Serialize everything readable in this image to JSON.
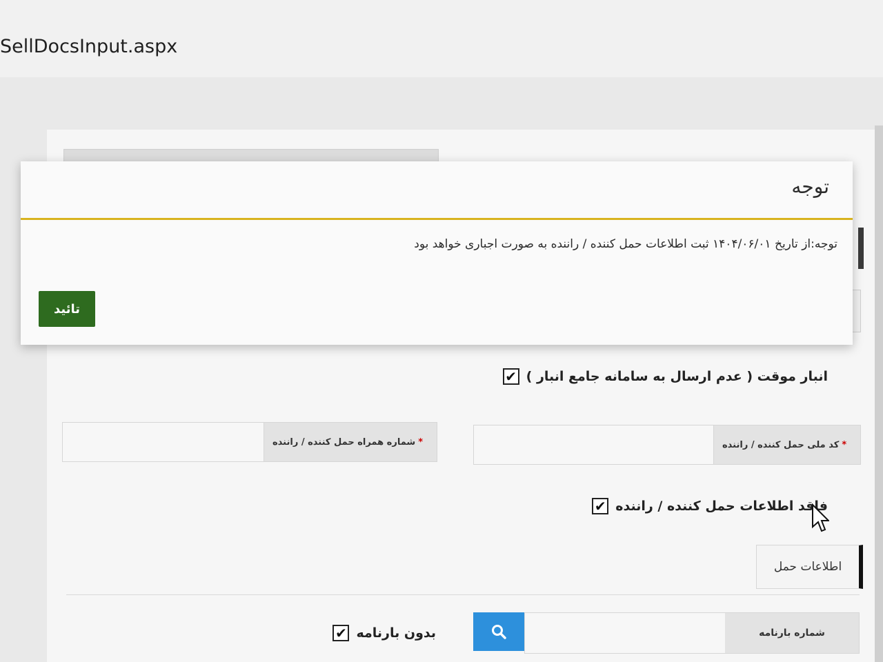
{
  "browser": {
    "url_text": "SellDocsInput.aspx"
  },
  "modal": {
    "title": "توجه",
    "message": "توجه:از تاریخ ۱۴۰۴/۰۶/۰۱ ثبت اطلاعات حمل کننده / راننده به صورت اجباری خواهد بود",
    "confirm_label": "تائید",
    "accent_color": "#d8b31f"
  },
  "form": {
    "temp_warehouse": {
      "label": "انبار موقت ( عدم ارسال به سامانه جامع انبار )",
      "checked": true
    },
    "national_code": {
      "label": "کد ملی حمل کننده / راننده",
      "required_mark": "*"
    },
    "mobile": {
      "label": "شماره همراه حمل کننده / راننده",
      "required_mark": "*"
    },
    "no_driver_info": {
      "label": "فاقد اطلاعات حمل کننده / راننده",
      "checked": true
    },
    "shipping_info_label": "اطلاعات حمل",
    "waybill": {
      "label": "شماره بارنامه",
      "value": ""
    },
    "no_waybill": {
      "label": "بدون بارنامه",
      "checked": true
    },
    "check_mark": "✔"
  },
  "colors": {
    "confirm_button": "#2e6b1f",
    "search_button": "#2d90dc"
  },
  "icons": {
    "search": "search-icon",
    "check": "check-icon",
    "cursor": "mouse-pointer-icon"
  }
}
